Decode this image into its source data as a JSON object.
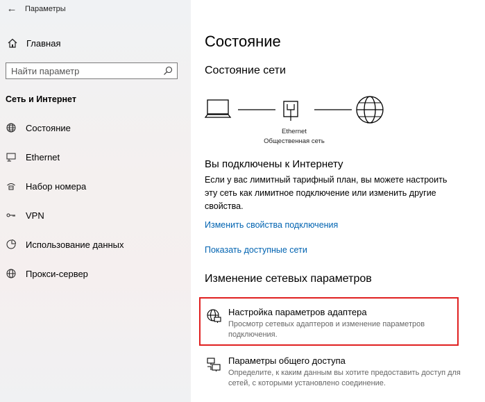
{
  "window": {
    "title": "Параметры",
    "back_label": "←"
  },
  "sidebar": {
    "home_label": "Главная",
    "search_placeholder": "Найти параметр",
    "section_title": "Сеть и Интернет",
    "items": [
      {
        "label": "Состояние",
        "icon": "globe-icon"
      },
      {
        "label": "Ethernet",
        "icon": "ethernet-icon"
      },
      {
        "label": "Набор номера",
        "icon": "dialup-icon"
      },
      {
        "label": "VPN",
        "icon": "vpn-icon"
      },
      {
        "label": "Использование данных",
        "icon": "data-usage-icon"
      },
      {
        "label": "Прокси-сервер",
        "icon": "globe-icon"
      }
    ]
  },
  "main": {
    "title": "Состояние",
    "network_status_title": "Состояние сети",
    "diagram": {
      "adapter_name": "Ethernet",
      "network_type": "Общественная сеть"
    },
    "connected_title": "Вы подключены к Интернету",
    "connected_desc": "Если у вас лимитный тарифный план, вы можете настроить эту сеть как лимитное подключение или изменить другие свойства.",
    "links": [
      "Изменить свойства подключения",
      "Показать доступные сети"
    ],
    "change_title": "Изменение сетевых параметров",
    "options": [
      {
        "title": "Настройка параметров адаптера",
        "desc": "Просмотр сетевых адаптеров и изменение параметров подключения.",
        "icon": "adapter-icon"
      },
      {
        "title": "Параметры общего доступа",
        "desc": "Определите, к каким данным вы хотите предоставить доступ для сетей, с которыми установлено соединение.",
        "icon": "sharing-icon"
      }
    ]
  },
  "colors": {
    "link": "#0063b1",
    "highlight_border": "#e02020"
  }
}
